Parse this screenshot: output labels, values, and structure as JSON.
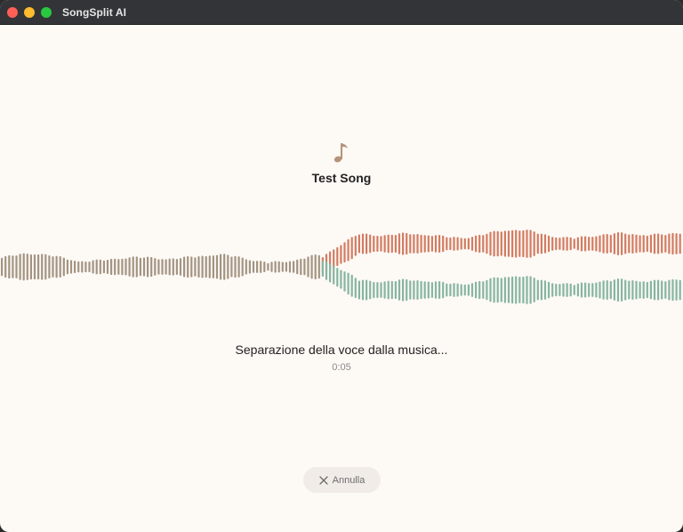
{
  "window": {
    "title": "SongSplit AI"
  },
  "song": {
    "title": "Test Song",
    "icon": "music-note-icon"
  },
  "progress": {
    "status": "Separazione della voce dalla musica...",
    "elapsed": "0:05"
  },
  "actions": {
    "cancel_label": "Annulla",
    "cancel_icon": "close-icon"
  },
  "colors": {
    "background": "#fdf9f5",
    "original_wave": "#a39482",
    "vocals_wave": "#d27c62",
    "music_wave": "#86b5a2",
    "note_icon": "#b5937a"
  }
}
